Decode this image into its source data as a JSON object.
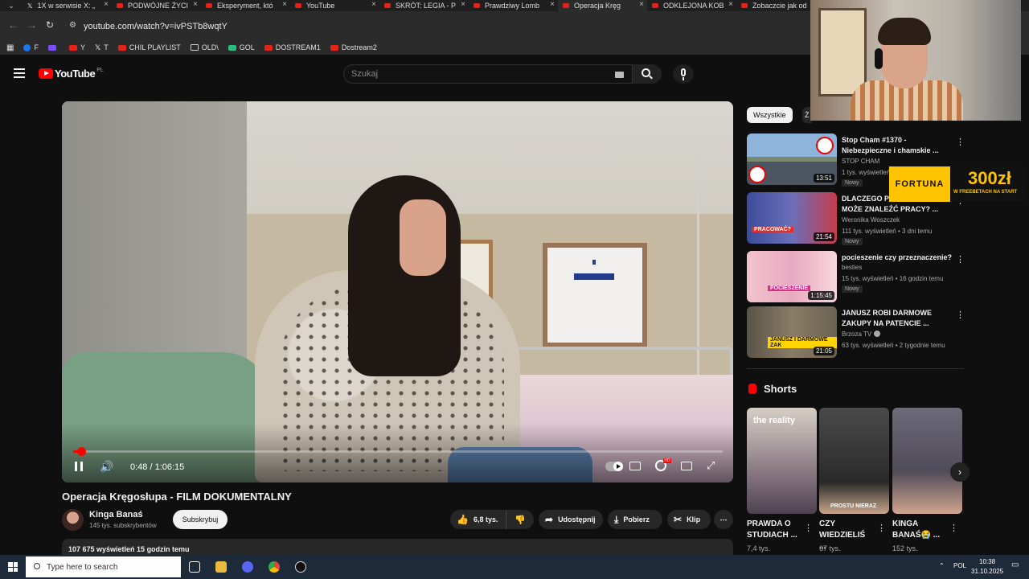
{
  "browser": {
    "tabs": [
      {
        "label": "1X w serwisie X: „",
        "icon": "x-logo-icon",
        "active": false
      },
      {
        "label": "PODWÓJNE ŻYCI",
        "icon": "youtube-icon",
        "active": false
      },
      {
        "label": "Eksperyment, któ",
        "icon": "youtube-icon",
        "active": false
      },
      {
        "label": "YouTube",
        "icon": "youtube-icon",
        "active": false
      },
      {
        "label": "SKRÓT: LEGIA - P",
        "icon": "youtube-icon",
        "active": false
      },
      {
        "label": "Prawdziwy Lomb",
        "icon": "youtube-icon",
        "active": false
      },
      {
        "label": "Operacja Kręg",
        "icon": "youtube-icon",
        "active": true
      },
      {
        "label": "ODKLEJONA KOB",
        "icon": "youtube-icon",
        "active": false
      },
      {
        "label": "Zobaczcie jak od",
        "icon": "youtube-icon",
        "active": false
      }
    ],
    "url": "youtube.com/watch?v=ivPSTb8wqtY",
    "bookmarks": [
      {
        "label": "F",
        "icon": "facebook-icon"
      },
      {
        "label": "",
        "icon": "twitch-icon"
      },
      {
        "label": "Y",
        "icon": "youtube-icon"
      },
      {
        "label": "T",
        "icon": "x-logo-icon"
      },
      {
        "label": "CHIL PLAYLIST",
        "icon": "youtube-icon"
      },
      {
        "label": "OLD\\",
        "icon": "folder-icon"
      },
      {
        "label": "GOL",
        "icon": "gol-icon"
      },
      {
        "label": "DOSTREAM1",
        "icon": "youtube-icon"
      },
      {
        "label": "Dostream2",
        "icon": "youtube-icon"
      }
    ]
  },
  "youtube": {
    "logo_text": "YouTube",
    "logo_region": "PL",
    "search_placeholder": "Szukaj",
    "accent": "#ff0000"
  },
  "player": {
    "time": "0:48 / 1:06:15",
    "progress_fraction": 0.012,
    "hd_badge": "HD"
  },
  "video": {
    "title": "Operacja Kręgosłupa - FILM DOKUMENTALNY",
    "channel": "Kinga Banaś",
    "subscribers": "145 tys. subskrybentów",
    "subscribe_label": "Subskrybuj",
    "likes": "6,8 tys.",
    "share_label": "Udostępnij",
    "download_label": "Pobierz",
    "clip_label": "Klip",
    "description_meta": "107 675 wyświetleń  15 godzin temu"
  },
  "sidebar": {
    "chips": [
      "Wszystkie",
      "Ż"
    ],
    "recommendations": [
      {
        "title": "Stop Cham #1370 - Niebezpieczne i chamskie ...",
        "channel": "STOP CHAM",
        "meta": "1 tys. wyświetleń",
        "badge": "Nowy",
        "duration": "13:51",
        "verified": false
      },
      {
        "title": "DLACZEGO POKOLENIE NIE MOŻE ZNALEŹĆ PRACY? ...",
        "channel": "Weronika Woszczek",
        "meta": "111 tys. wyświetleń • 3 dni temu",
        "badge": "Nowy",
        "duration": "21:54",
        "verified": false
      },
      {
        "title": "pocieszenie czy przeznaczenie?",
        "channel": "besties",
        "meta": "15 tys. wyświetleń • 16 godzin temu",
        "badge": "Nowy",
        "duration": "1:15:45",
        "verified": false
      },
      {
        "title": "JANUSZ ROBI DARMOWE ZAKUPY NA PATENCIE ...",
        "channel": "Brzoza TV",
        "meta": "63 tys. wyświetleń • 2 tygodnie temu",
        "badge": "",
        "duration": "21:05",
        "verified": true
      }
    ],
    "shorts_heading": "Shorts",
    "shorts": [
      {
        "title": "PRAWDA O STUDIACH ...",
        "views": "7,4 tys."
      },
      {
        "title": "CZY WIEDZIELIŚ ...",
        "views": "67 tys."
      },
      {
        "title": "KINGA BANAŚ😭 ...",
        "views": "152 tys."
      }
    ]
  },
  "ad": {
    "brand": "FORTUNA",
    "amount": "300zł",
    "tagline": "W FREEBETACH NA START"
  },
  "taskbar": {
    "search_placeholder": "Type here to search",
    "language": "POL",
    "time": "10:38",
    "date": "31.10.2025"
  }
}
